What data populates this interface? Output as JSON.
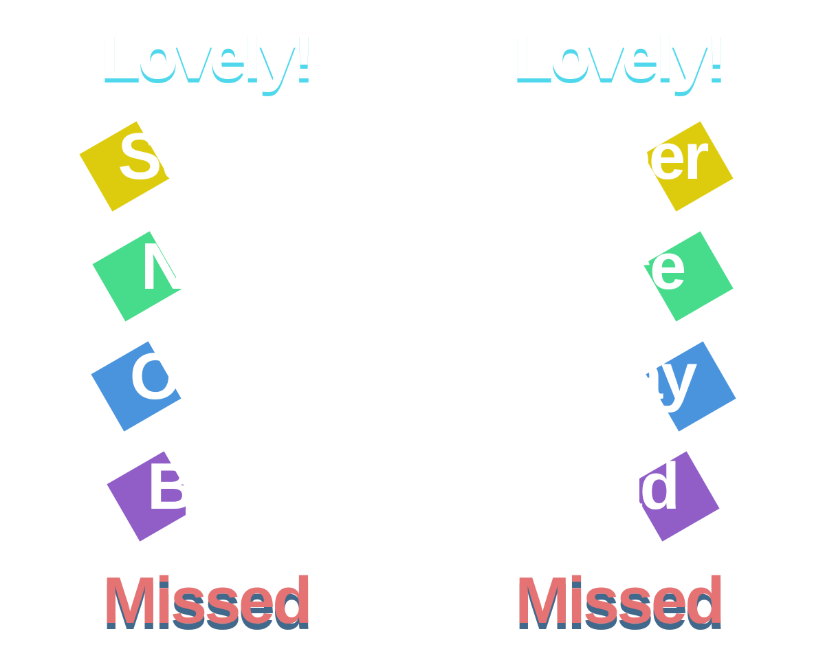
{
  "colors": {
    "lovely_fill": "#ffffff",
    "lovely_shadow": "#4fd8ec",
    "super": "#ddcc0e",
    "nice": "#47dc8b",
    "okay": "#4a94de",
    "bad": "#915ec7",
    "missed_fill": "#e57373",
    "missed_shadow": "#41698c"
  },
  "left": {
    "lovely": "Lovely!",
    "super": "Super",
    "nice": "Nice",
    "okay": "Okay",
    "bad": "Bad",
    "missed": "Missed"
  },
  "right": {
    "lovely": "Lovely!",
    "super": "Super",
    "nice": "Nice",
    "okay": "Okay",
    "bad": "Bad",
    "missed": "Missed"
  }
}
